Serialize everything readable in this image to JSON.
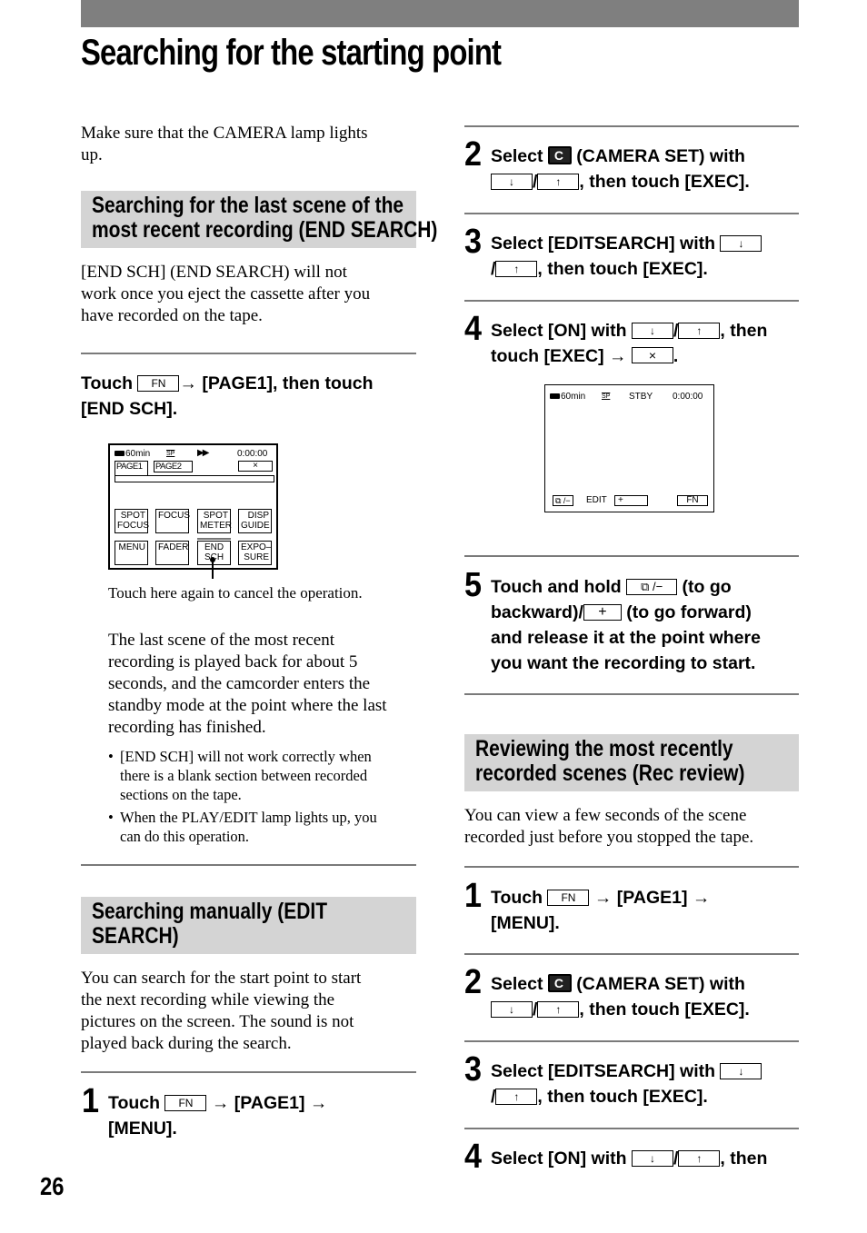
{
  "page": {
    "title": "Searching for the starting point",
    "page_number": "26"
  },
  "left": {
    "intro": [
      "Make sure that the CAMERA lamp lights",
      "up."
    ],
    "end_search": {
      "heading": [
        "Searching for the last scene of the",
        "most recent recording (END SEARCH)"
      ],
      "desc": [
        "[END SCH] (END SEARCH) will not",
        "work once you eject the cassette after you",
        "have recorded on the tape."
      ],
      "instruction": {
        "pre": "Touch",
        "fn_button": "FN",
        "arrow": "→",
        "post": "[PAGE1], then touch",
        "line2": "[END SCH]."
      },
      "lcd": {
        "battery": "60min",
        "sp": "SP",
        "play_icon": "▶▶",
        "timecode": "0:00:00",
        "tabs": [
          "PAGE1",
          "PAGE2"
        ],
        "close": "×",
        "buttons_row1": [
          [
            "SPOT",
            "FOCUS"
          ],
          [
            "FOCUS",
            ""
          ],
          [
            "SPOT",
            "METER"
          ],
          [
            "DISP",
            "GUIDE"
          ]
        ],
        "buttons_row2": [
          [
            "MENU",
            ""
          ],
          [
            "FADER",
            ""
          ],
          [
            "END",
            "SCH"
          ],
          [
            "EXPO–",
            "SURE"
          ]
        ]
      },
      "callout": "Touch here again to cancel the operation.",
      "result": [
        "The last scene of the most recent",
        "recording is played back for about 5",
        "seconds, and the camcorder enters the",
        "standby mode at the point where the last",
        "recording has finished."
      ],
      "notes": [
        [
          "[END SCH] will not work correctly when",
          "there is a blank section between recorded",
          "sections on the tape."
        ],
        [
          "When the PLAY/EDIT lamp lights up, you",
          "can do this operation."
        ]
      ]
    },
    "edit_search": {
      "heading": [
        "Searching manually (EDIT",
        "SEARCH)"
      ],
      "desc": [
        "You can search for the start point to start",
        "the next recording while viewing the",
        "pictures on the screen. The sound is not",
        "played back during the search."
      ],
      "step1": {
        "num": "1",
        "pre": "Touch",
        "fn": "FN",
        "mid": "→ [PAGE1] →",
        "line2": "[MENU]."
      }
    }
  },
  "right": {
    "step2": {
      "num": "2",
      "pre": "Select",
      "post": "(CAMERA SET) with",
      "down": "↓",
      "up": "↑",
      "line2_post": ", then touch [EXEC]."
    },
    "step3": {
      "num": "3",
      "pre": "Select [EDITSEARCH] with",
      "down": "↓",
      "up": "↑",
      "line2_post": ", then touch [EXEC]."
    },
    "step4": {
      "num": "4",
      "pre": "Select [ON] with",
      "down": "↓",
      "up": "↑",
      "post": ", then",
      "line2_pre": "touch [EXEC] →",
      "close": "×",
      "line2_post": "."
    },
    "lcd2": {
      "battery": "60min",
      "sp": "SP",
      "status": "STBY",
      "timecode": "0:00:00",
      "back_btn": "⧉ /−",
      "edit_label": "EDIT",
      "plus_btn": "+",
      "fn_btn": "FN"
    },
    "step5": {
      "num": "5",
      "lines": [
        "Touch and hold",
        "(to go",
        "backward)/",
        "(to go forward)",
        "and release it at the point where",
        "you want the recording to start."
      ],
      "back_btn": "⧉ /−",
      "plus_btn": "+"
    },
    "rec_review": {
      "heading": [
        "Reviewing the most recently",
        "recorded scenes (Rec review)"
      ],
      "desc": [
        "You can view a few seconds of the scene",
        "recorded just before you stopped the tape."
      ],
      "step1": {
        "num": "1",
        "pre": "Touch",
        "fn": "FN",
        "mid": "→ [PAGE1] →",
        "line2": "[MENU]."
      },
      "step2": {
        "num": "2",
        "pre": "Select",
        "post": "(CAMERA SET) with",
        "down": "↓",
        "up": "↑",
        "line2_post": ", then touch [EXEC]."
      },
      "step3": {
        "num": "3",
        "pre": "Select [EDITSEARCH] with",
        "down": "↓",
        "up": "↑",
        "line2_post": ", then touch [EXEC]."
      },
      "step4": {
        "num": "4",
        "pre": "Select [ON] with",
        "down": "↓",
        "up": "↑",
        "post": ", then"
      }
    }
  }
}
